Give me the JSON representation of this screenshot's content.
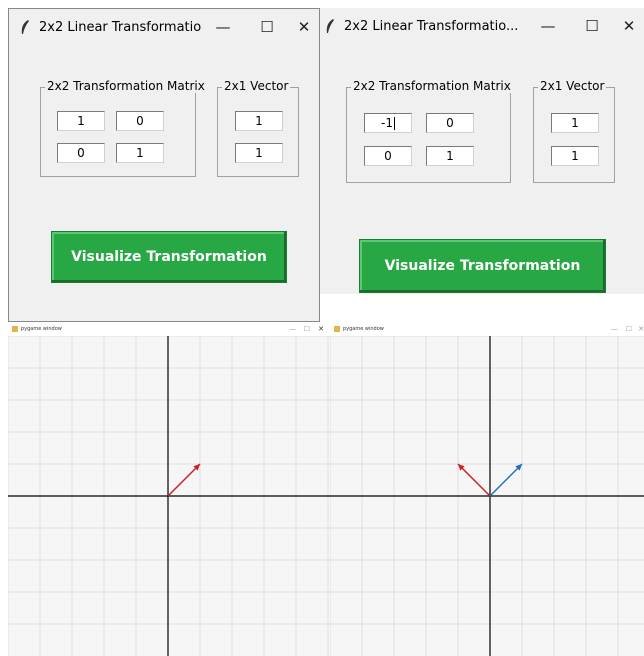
{
  "left_app": {
    "title": "2x2 Linear Transformatio...",
    "matrix_label": "2x2 Transformation Matrix",
    "vector_label": "2x1 Vector",
    "matrix": [
      "1",
      "0",
      "0",
      "1"
    ],
    "vector": [
      "1",
      "1"
    ],
    "button_label": "Visualize Transformation"
  },
  "right_app": {
    "title": "2x2 Linear Transformatio...",
    "matrix_label": "2x2 Transformation Matrix",
    "vector_label": "2x1 Vector",
    "matrix": [
      "-1",
      "0",
      "0",
      "1"
    ],
    "vector": [
      "1",
      "1"
    ],
    "button_label": "Visualize Transformation"
  },
  "window_controls": {
    "minimize": "—",
    "maximize": "☐",
    "close": "✕"
  },
  "pygame_left": {
    "title": "pygame window",
    "vectors": [
      {
        "x": 1,
        "y": 1,
        "color": "#cc2222"
      }
    ]
  },
  "pygame_right": {
    "title": "pygame window",
    "vectors": [
      {
        "x": -1,
        "y": 1,
        "color": "#cc2222"
      },
      {
        "x": 1,
        "y": 1,
        "color": "#1f6fbf"
      }
    ]
  },
  "colors": {
    "button": "#28a745",
    "original_vector": "#1f6fbf",
    "transformed_vector": "#cc2222",
    "axis": "#000000",
    "grid": "#dedede"
  }
}
